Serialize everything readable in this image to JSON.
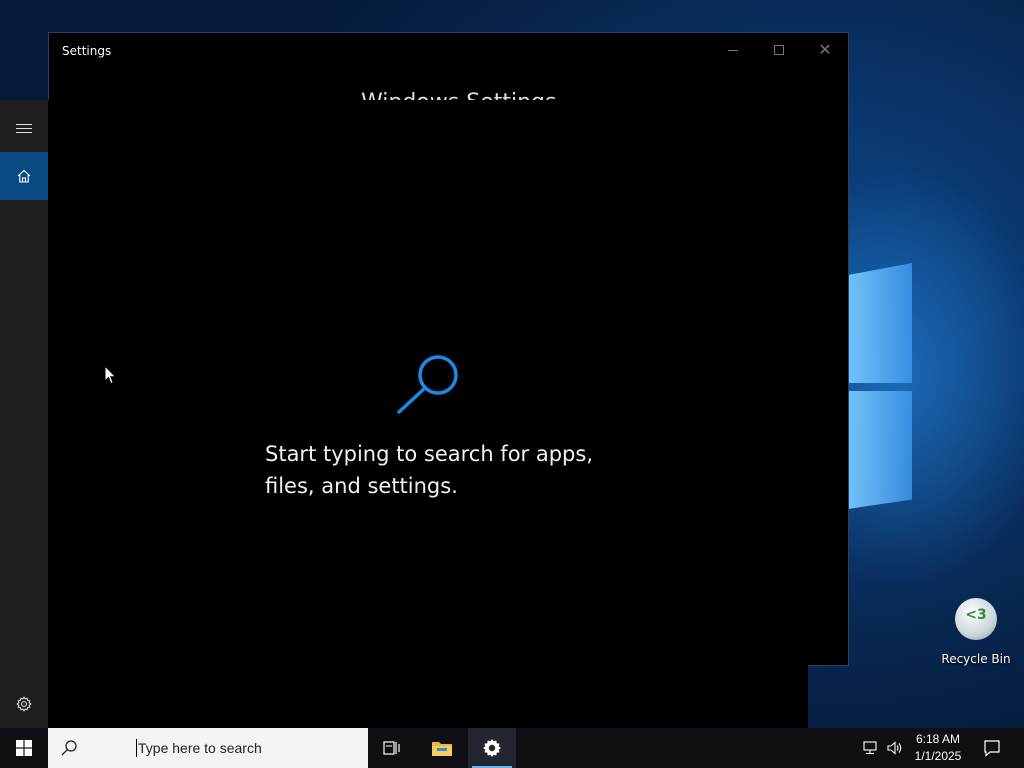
{
  "window": {
    "title": "Settings",
    "heading": "Windows Settings"
  },
  "search_flyout": {
    "prompt_line1": "Start typing to search for apps,",
    "prompt_line2": "files, and settings."
  },
  "desktop": {
    "recycle_bin_label": "Recycle Bin"
  },
  "taskbar": {
    "search_placeholder": "Type here to search",
    "clock_time": "6:18 AM",
    "clock_date": "1/1/2025"
  },
  "colors": {
    "accent": "#0a4a82",
    "search_icon_blue": "#1e88e5",
    "taskbar_bg": "#0f0f14"
  },
  "icons": [
    "menu-icon",
    "home-icon",
    "gear-icon",
    "magnifier-icon",
    "windows-logo-icon",
    "task-view-icon",
    "file-explorer-icon",
    "network-icon",
    "volume-icon",
    "notification-icon"
  ]
}
